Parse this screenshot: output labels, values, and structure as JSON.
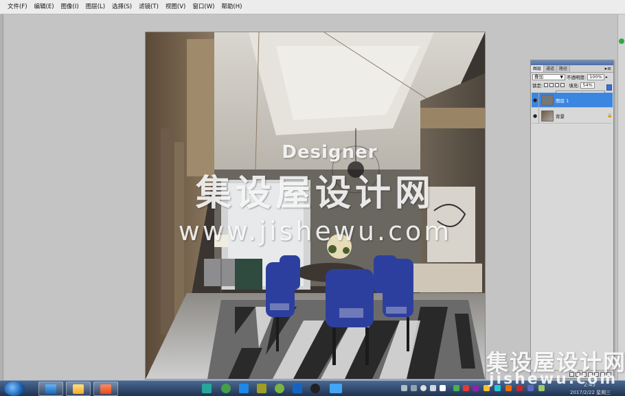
{
  "menubar": {
    "items": [
      {
        "label": "文件(F)"
      },
      {
        "label": "编辑(E)"
      },
      {
        "label": "图像(I)"
      },
      {
        "label": "图层(L)"
      },
      {
        "label": "选择(S)"
      },
      {
        "label": "滤镜(T)"
      },
      {
        "label": "视图(V)"
      },
      {
        "label": "窗口(W)"
      },
      {
        "label": "帮助(H)"
      }
    ]
  },
  "canvas": {
    "watermark_designer": "Designer",
    "watermark_cn": "集设屋设计网",
    "watermark_url": "www.jishewu.com"
  },
  "layers_panel": {
    "tabs": [
      {
        "label": "图层"
      },
      {
        "label": "通道"
      },
      {
        "label": "路径"
      }
    ],
    "blend_mode": "叠加",
    "opacity_label": "不透明度:",
    "opacity_value": "100%",
    "lock_label": "锁定:",
    "fill_label": "填充:",
    "fill_value": "54%",
    "fill_slider_value": 0.54,
    "layers": [
      {
        "name": "图层 1",
        "selected": true
      },
      {
        "name": "背景",
        "selected": false,
        "locked": true
      }
    ]
  },
  "bottom_watermark": {
    "cn": "集设屋设计网",
    "url": "jishewu.com"
  },
  "taskbar": {
    "time": "2:45",
    "date": "2017/2/22 星期三"
  },
  "colors": {
    "selection": "#3b86e0",
    "taskbar": "#1f3352",
    "chair_blue": "#2d3f9e"
  }
}
